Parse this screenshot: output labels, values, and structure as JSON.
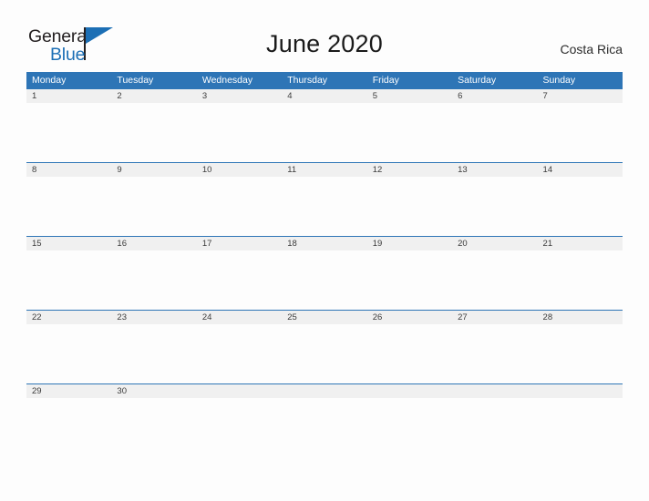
{
  "brand": {
    "name_part1": "General",
    "name_part2": "Blue",
    "flag_icon": "flag-triangle-icon"
  },
  "header": {
    "title": "June 2020",
    "locale": "Costa Rica"
  },
  "colors": {
    "header_blue": "#2e75b6",
    "row_divider_blue": "#2e75b6",
    "date_band_gray": "#f0f0f0",
    "logo_blue": "#1c6fb5",
    "page_background": "#fdfdfd",
    "text_dark": "#231f20"
  },
  "calendar": {
    "month": "June",
    "year": "2020",
    "weekday_headers": [
      "Monday",
      "Tuesday",
      "Wednesday",
      "Thursday",
      "Friday",
      "Saturday",
      "Sunday"
    ],
    "weeks": [
      [
        "1",
        "2",
        "3",
        "4",
        "5",
        "6",
        "7"
      ],
      [
        "8",
        "9",
        "10",
        "11",
        "12",
        "13",
        "14"
      ],
      [
        "15",
        "16",
        "17",
        "18",
        "19",
        "20",
        "21"
      ],
      [
        "22",
        "23",
        "24",
        "25",
        "26",
        "27",
        "28"
      ],
      [
        "29",
        "30",
        "",
        "",
        "",
        "",
        ""
      ]
    ]
  }
}
